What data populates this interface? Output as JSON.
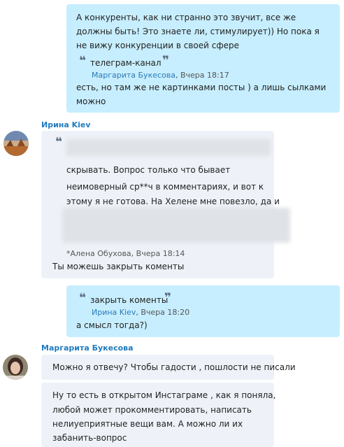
{
  "messages": [
    {
      "lines": [
        "А конкуренты, как ни странно это звучит, все же",
        "должны быть! Это знаете ли, стимулирует)) Но пока я",
        "не вижу конкуренции в своей сфере"
      ],
      "quote": {
        "text": "телеграм-канал",
        "author": "Маргарита Букесова",
        "time": ", Вчера 18:17"
      },
      "after": [
        "есть, но там же не картинками посты )  а лишь сылками",
        "можно"
      ]
    },
    {
      "sender": "Ирина Kiev",
      "lines": [
        "скрывать. Вопрос только что бывает",
        "неимоверный ср**ч в комментариях, и вот к",
        "этому я не готова.  На Хелене мне повезло, да и"
      ],
      "meta": "*Алена Обуховa, Вчера 18:14",
      "after": "Ты можешь закрыть коменты"
    },
    {
      "quote": {
        "text": "закрыть коменты",
        "author": "Ирина Kiev",
        "time": ", Вчера 18:20"
      },
      "after": "а смысл тогда?)"
    },
    {
      "sender": "Маргарита Букесова",
      "line": "Можно я отвечу? Чтобы гадости , пошлости не писали",
      "lines2": [
        "Ну то есть в открытом Инстаграме , как я поняла,",
        "любой может прокомментировать, написать",
        "нелиуеприятные вещи вам. А можно ли их",
        "забанить-вопрос"
      ]
    }
  ],
  "icons": {
    "open_quote": "❝",
    "close_quote": "❞"
  }
}
